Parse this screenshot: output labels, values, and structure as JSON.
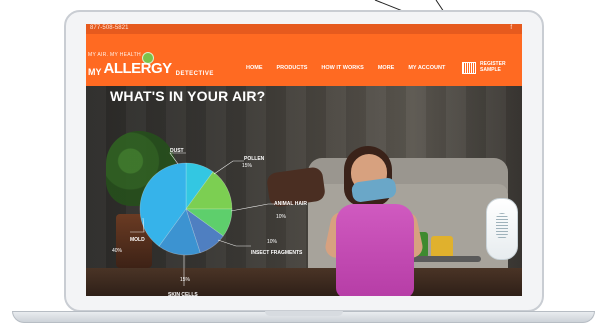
{
  "top_bar": {
    "phone": "877-508-5821",
    "social": "f"
  },
  "brand": {
    "tagline": "MY AIR. MY HEALTH",
    "my": "MY",
    "allergy": "ALLERGY",
    "detective": "DETECTIVE"
  },
  "nav": {
    "items": [
      {
        "label": "HOME"
      },
      {
        "label": "PRODUCTS"
      },
      {
        "label": "HOW IT WORKS"
      },
      {
        "label": "MORE"
      },
      {
        "label": "MY ACCOUNT"
      }
    ],
    "register_sample": {
      "line1": "REGISTER",
      "line2": "SAMPLE"
    }
  },
  "hero": {
    "heading": "WHAT'S IN YOUR AIR?"
  },
  "chart_data": {
    "type": "pie",
    "categories": [
      "Dust",
      "Pollen",
      "Animal Hair",
      "Insect Fragments",
      "Skin Cells",
      "Mold"
    ],
    "values": [
      10,
      15,
      10,
      10,
      15,
      40
    ],
    "value_labels": [
      "",
      "15%",
      "10%",
      "10%",
      "15%",
      "40%"
    ],
    "label_names": [
      "DUST",
      "POLLEN",
      "ANIMAL HAIR",
      "INSECT FRAGMENTS",
      "SKIN CELLS",
      "MOLD"
    ],
    "colors": [
      "#33c7e2",
      "#7ccf52",
      "#5ecf6c",
      "#4f7fc1",
      "#3c93d1",
      "#36b3ea"
    ]
  }
}
